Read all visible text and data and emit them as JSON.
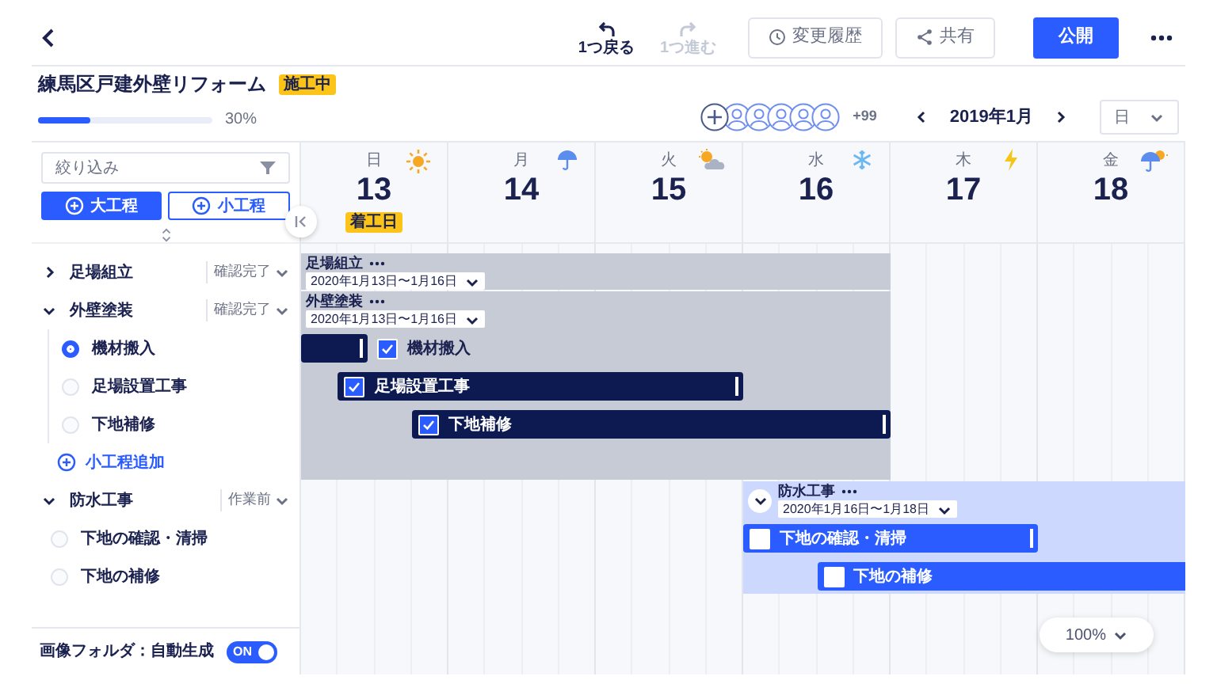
{
  "toolbar": {
    "undo": {
      "label": "1つ戻る",
      "disabled": false
    },
    "redo": {
      "label": "1つ進む",
      "disabled": true
    },
    "history_button": "変更履歴",
    "share_button": "共有",
    "publish_button": "公開"
  },
  "project": {
    "title": "練馬区戸建外壁リフォーム",
    "status": "施工中",
    "level": 0.3,
    "progress": "30%"
  },
  "members": {
    "more": "+99"
  },
  "calendar": {
    "month": "2019年1月",
    "view": "日",
    "days": [
      {
        "weekday": "日",
        "date": "13",
        "kind": "sunny",
        "badge": "着工日"
      },
      {
        "weekday": "月",
        "date": "14",
        "kind": "rain"
      },
      {
        "weekday": "火",
        "date": "15",
        "kind": "cloudy"
      },
      {
        "weekday": "水",
        "date": "16",
        "kind": "snow"
      },
      {
        "weekday": "木",
        "date": "17",
        "kind": "thunder"
      },
      {
        "weekday": "金",
        "date": "18",
        "kind": "showers"
      }
    ]
  },
  "sidebar": {
    "filter": "絞り込み",
    "add_major": "大工程",
    "add_minor": "小工程",
    "processes": [
      {
        "name": "足場組立",
        "status": "確認完了",
        "expanded": false
      },
      {
        "name": "外壁塗装",
        "status": "確認完了",
        "expanded": true,
        "children": [
          {
            "name": "機材搬入",
            "selected": true
          },
          {
            "name": "足場設置工事",
            "selected": false
          },
          {
            "name": "下地補修",
            "selected": false
          }
        ],
        "add_label": "小工程追加"
      },
      {
        "name": "防水工事",
        "status": "作業前",
        "expanded": true,
        "children": [
          {
            "name": "下地の確認・清掃",
            "selected": false
          },
          {
            "name": "下地の補修",
            "selected": false
          }
        ]
      }
    ],
    "footer": {
      "label": "画像フォルダ：自動生成",
      "toggle": "ON",
      "on": true
    }
  },
  "gantt": {
    "groups": [
      {
        "name": "足場組立",
        "range": "2020年1月13日〜1月16日",
        "kind": "done"
      },
      {
        "name": "外壁塗装",
        "range": "2020年1月13日〜1月16日",
        "kind": "done",
        "tasks": [
          {
            "name": "機材搬入",
            "checked": true
          },
          {
            "name": "足場設置工事",
            "checked": true
          },
          {
            "name": "下地補修",
            "checked": true
          }
        ]
      },
      {
        "name": "防水工事",
        "range": "2020年1月16日〜1月18日",
        "kind": "active",
        "tasks": [
          {
            "name": "下地の確認・清掃",
            "checked": false
          },
          {
            "name": "下地の補修",
            "checked": false
          }
        ]
      }
    ],
    "zoom": "100%"
  }
}
